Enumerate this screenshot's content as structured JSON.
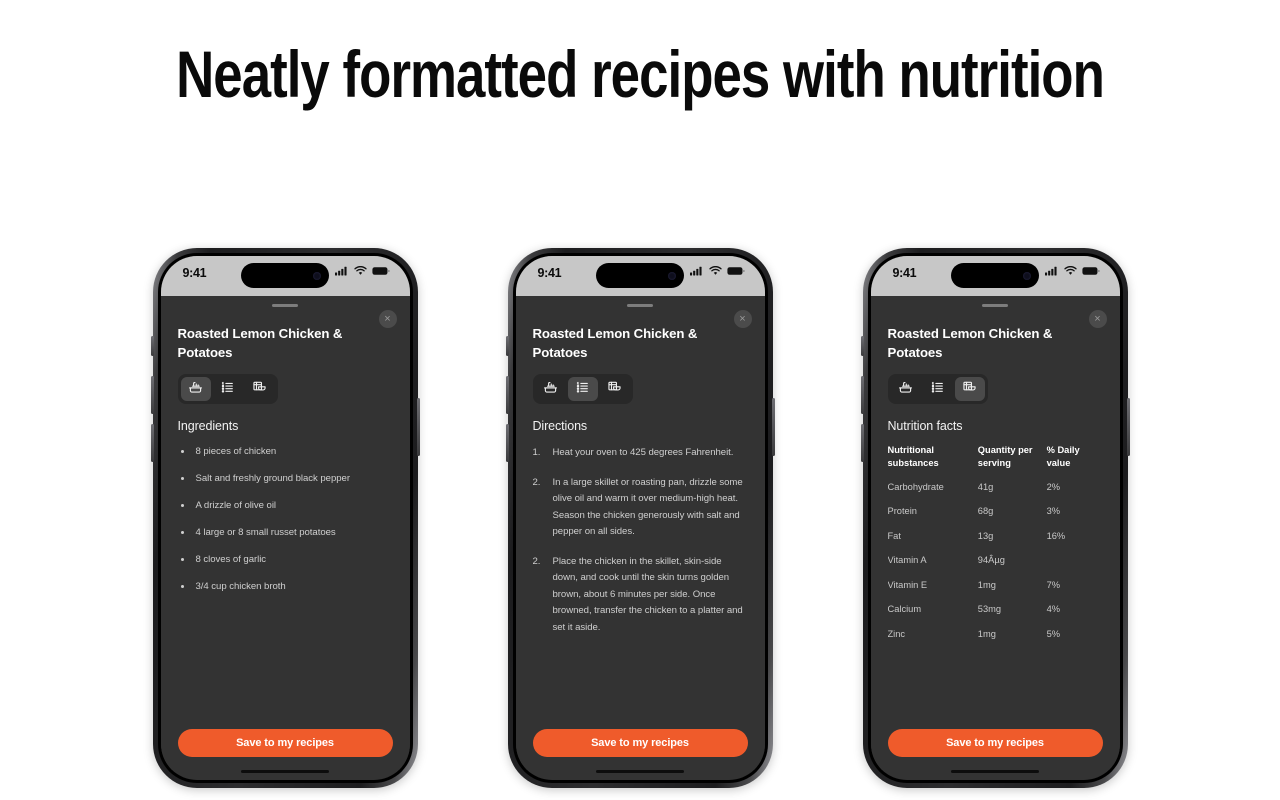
{
  "page": {
    "title": "Neatly formatted recipes with nutrition",
    "background_color": "#ffffff"
  },
  "theme": {
    "accent_color": "#ef5b2b",
    "sheet_background": "#333333",
    "status_bar_background": "#c7c7c7",
    "tab_bar_background": "#282828",
    "tab_active_background": "#4a4a4a"
  },
  "status_bar": {
    "time": "9:41",
    "icons": [
      "cellular-signal-icon",
      "wifi-icon",
      "battery-icon"
    ]
  },
  "sheet": {
    "recipe_title": "Roasted Lemon Chicken & Potatoes",
    "close_label": "×",
    "save_label": "Save to my recipes"
  },
  "tabs": [
    {
      "name": "ingredients",
      "icon": "cooking-pot-icon"
    },
    {
      "name": "directions",
      "icon": "numbered-list-icon"
    },
    {
      "name": "nutrition",
      "icon": "nutrition-table-icon"
    }
  ],
  "phones": [
    {
      "active_tab_index": 0,
      "section_title": "Ingredients",
      "ingredients": [
        "8 pieces of chicken",
        "Salt and freshly ground black pepper",
        "A drizzle of olive oil",
        "4 large or 8 small russet potatoes",
        "8 cloves of garlic",
        "3/4 cup chicken broth"
      ]
    },
    {
      "active_tab_index": 1,
      "section_title": "Directions",
      "directions": [
        {
          "number": "1.",
          "text": "Heat your oven to 425 degrees Fahrenheit."
        },
        {
          "number": "2.",
          "text": "In a large skillet or roasting pan, drizzle some olive oil and warm it over medium-high heat. Season the chicken generously with salt and pepper on all sides."
        },
        {
          "number": "2.",
          "text": " Place the chicken in the skillet, skin-side down, and cook until the skin turns golden brown, about 6 minutes per side. Once browned, transfer the chicken to a platter and set it aside."
        }
      ]
    },
    {
      "active_tab_index": 2,
      "section_title": "Nutrition facts",
      "nutrition": {
        "headers": [
          "Nutritional substances",
          "Quantity per serving",
          "% Daily value"
        ],
        "rows": [
          [
            "Carbohydrate",
            "41g",
            "2%"
          ],
          [
            "Protein",
            "68g",
            "3%"
          ],
          [
            "Fat",
            "13g",
            "16%"
          ],
          [
            "Vitamin A",
            "94Âµg",
            ""
          ],
          [
            "Vitamin E",
            "1mg",
            "7%"
          ],
          [
            "Calcium",
            "53mg",
            "4%"
          ],
          [
            "Zinc",
            "1mg",
            "5%"
          ]
        ]
      }
    }
  ]
}
